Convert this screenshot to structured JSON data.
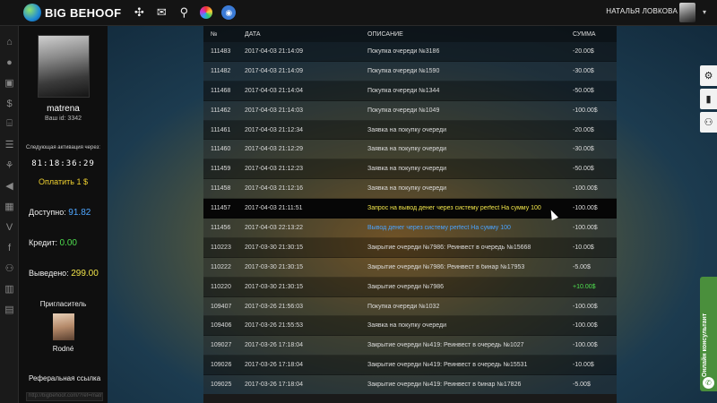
{
  "header": {
    "logo_big": "BIG",
    "logo_behoof": "BEHOOF",
    "icons": [
      "crosshair-icon",
      "mail-icon",
      "search-icon",
      "wheel-icon",
      "round-app-icon"
    ],
    "user_name": "НАТАЛЬЯ ЛОВКОВА",
    "caret": "▾"
  },
  "rail": {
    "icons": [
      "home-icon",
      "user-icon",
      "briefcase-icon",
      "money-bag-icon",
      "bank-icon",
      "list-icon",
      "network-icon",
      "megaphone-icon",
      "gift-icon",
      "vk-icon",
      "facebook-icon",
      "people-icon",
      "chart-icon",
      "document-icon"
    ]
  },
  "profile": {
    "username": "matrena",
    "user_id": "Ваш id: 3342",
    "activation_label": "Следующая активация через:",
    "timer": "81:18:36:29",
    "pay_label": "Оплатить 1 $",
    "available_label": "Доступно:",
    "available_value": "91.82",
    "credit_label": "Кредит:",
    "credit_value": "0.00",
    "withdrawn_label": "Выведено:",
    "withdrawn_value": "299.00",
    "inviter_label": "Пригласитель",
    "inviter_name": "Rodné",
    "ref_label": "Реферальная ссылка",
    "ref_value": "http://bigbehoof.com/?ref=matrena"
  },
  "table": {
    "headers": [
      "№",
      "ДАТА",
      "ОПИСАНИЕ",
      "СУММА"
    ],
    "rows": [
      {
        "no": "111483",
        "date": "2017-04-03 21:14:09",
        "desc": "Покупка очереди №3186",
        "sum": "-20.00$",
        "desc_color": "",
        "sum_color": ""
      },
      {
        "no": "111482",
        "date": "2017-04-03 21:14:09",
        "desc": "Покупка очереди №1590",
        "sum": "-30.00$",
        "desc_color": "",
        "sum_color": ""
      },
      {
        "no": "111468",
        "date": "2017-04-03 21:14:04",
        "desc": "Покупка очереди №1344",
        "sum": "-50.00$",
        "desc_color": "",
        "sum_color": ""
      },
      {
        "no": "111462",
        "date": "2017-04-03 21:14:03",
        "desc": "Покупка очереди №1049",
        "sum": "-100.00$",
        "desc_color": "",
        "sum_color": ""
      },
      {
        "no": "111461",
        "date": "2017-04-03 21:12:34",
        "desc": "Заявка на покупку очереди",
        "sum": "-20.00$",
        "desc_color": "",
        "sum_color": ""
      },
      {
        "no": "111460",
        "date": "2017-04-03 21:12:29",
        "desc": "Заявка на покупку очереди",
        "sum": "-30.00$",
        "desc_color": "",
        "sum_color": ""
      },
      {
        "no": "111459",
        "date": "2017-04-03 21:12:23",
        "desc": "Заявка на покупку очереди",
        "sum": "-50.00$",
        "desc_color": "",
        "sum_color": ""
      },
      {
        "no": "111458",
        "date": "2017-04-03 21:12:16",
        "desc": "Заявка на покупку очереди",
        "sum": "-100.00$",
        "desc_color": "",
        "sum_color": ""
      },
      {
        "no": "111457",
        "date": "2017-04-03 21:11:51",
        "desc": "Запрос на вывод денег через систему perfect На сумму 100",
        "sum": "-100.00$",
        "desc_color": "yellow",
        "sum_color": "",
        "active": true
      },
      {
        "no": "111456",
        "date": "2017-04-03 22:13:22",
        "desc": "Вывод денег через систему perfect На сумму 100",
        "sum": "-100.00$",
        "desc_color": "blue",
        "sum_color": ""
      },
      {
        "no": "110223",
        "date": "2017-03-30 21:30:15",
        "desc": "Закрытие очереди №7986: Реинвест в очередь №15668",
        "sum": "-10.00$",
        "desc_color": "",
        "sum_color": ""
      },
      {
        "no": "110222",
        "date": "2017-03-30 21:30:15",
        "desc": "Закрытие очереди №7986: Реинвест в бинар №17953",
        "sum": "-5.00$",
        "desc_color": "",
        "sum_color": ""
      },
      {
        "no": "110220",
        "date": "2017-03-30 21:30:15",
        "desc": "Закрытие очереди №7986",
        "sum": "+10.00$",
        "desc_color": "",
        "sum_color": "green"
      },
      {
        "no": "109407",
        "date": "2017-03-26 21:56:03",
        "desc": "Покупка очереди №1032",
        "sum": "-100.00$",
        "desc_color": "",
        "sum_color": ""
      },
      {
        "no": "109406",
        "date": "2017-03-26 21:55:53",
        "desc": "Заявка на покупку очереди",
        "sum": "-100.00$",
        "desc_color": "",
        "sum_color": ""
      },
      {
        "no": "109027",
        "date": "2017-03-26 17:18:04",
        "desc": "Закрытие очереди №419: Реинвест в очередь №1027",
        "sum": "-100.00$",
        "desc_color": "",
        "sum_color": ""
      },
      {
        "no": "109026",
        "date": "2017-03-26 17:18:04",
        "desc": "Закрытие очереди №419: Реинвест в очередь №15531",
        "sum": "-10.00$",
        "desc_color": "",
        "sum_color": ""
      },
      {
        "no": "109025",
        "date": "2017-03-26 17:18:04",
        "desc": "Закрытие очереди №419: Реинвест в бинар №17826",
        "sum": "-5.00$",
        "desc_color": "",
        "sum_color": ""
      }
    ]
  },
  "side_buttons": [
    "gear-icon",
    "flag-icon",
    "group-icon"
  ],
  "consultant": {
    "label": "Онлайн консультант",
    "icon": "phone-icon"
  }
}
